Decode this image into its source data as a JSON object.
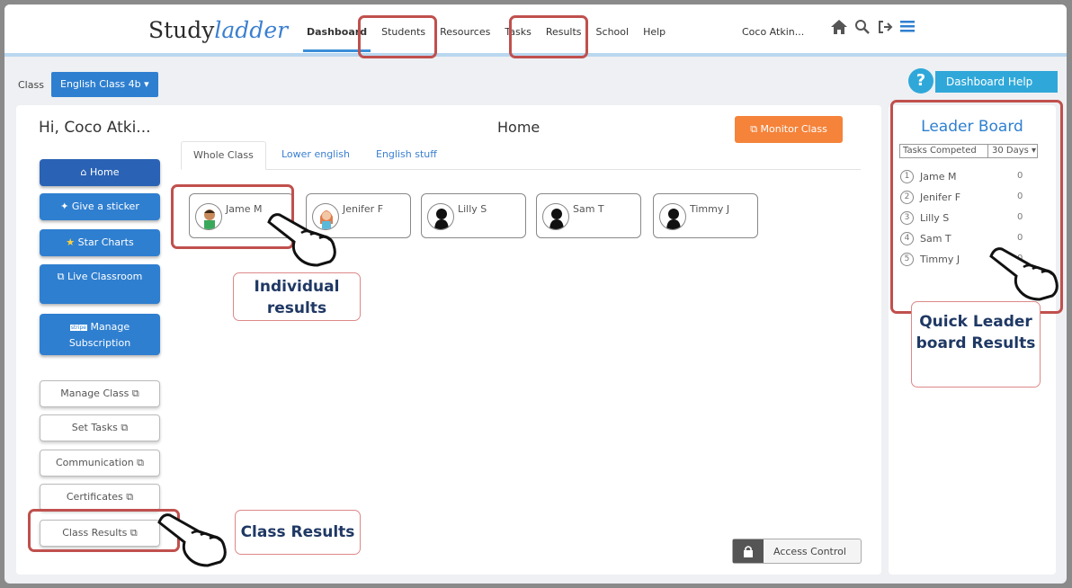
{
  "header": {
    "logo_main": "Study",
    "logo_italic": "ladder",
    "nav": [
      "Dashboard",
      "Students",
      "Resources",
      "Tasks",
      "Results",
      "School",
      "Help"
    ],
    "user_name": "Coco Atkin..."
  },
  "class_bar": {
    "label": "Class",
    "selected_class": "English Class 4b",
    "help_label": "Dashboard Help"
  },
  "main": {
    "greeting": "Hi, Coco Atki...",
    "title": "Home",
    "monitor_label": "Monitor Class",
    "tabs": [
      "Whole Class",
      "Lower english",
      "English stuff"
    ],
    "sidebar_primary": [
      {
        "label": "Home",
        "icon": "home-icon"
      },
      {
        "label": "Give a sticker",
        "icon": "sticker-icon"
      },
      {
        "label": "Star Charts",
        "icon": "star-chart-icon"
      },
      {
        "label": "Live Classroom",
        "icon": "classroom-icon"
      },
      {
        "label": "Manage Subscription",
        "icon": "stripe-icon",
        "icon_text": "stripe"
      }
    ],
    "sidebar_secondary": [
      "Manage Class",
      "Set Tasks",
      "Communication",
      "Certificates",
      "Class Results"
    ],
    "students": [
      {
        "name": "Jame M",
        "avatar": "boy"
      },
      {
        "name": "Jenifer F",
        "avatar": "girl"
      },
      {
        "name": "Lilly S",
        "avatar": "silhouette"
      },
      {
        "name": "Sam T",
        "avatar": "silhouette"
      },
      {
        "name": "Timmy J",
        "avatar": "silhouette"
      }
    ],
    "access_label": "Access Control"
  },
  "leaderboard": {
    "title": "Leader Board",
    "filter_type": "Tasks Competed",
    "filter_period": "30 Days",
    "entries": [
      {
        "rank": "1",
        "name": "Jame M",
        "score": "0"
      },
      {
        "rank": "2",
        "name": "Jenifer F",
        "score": "0"
      },
      {
        "rank": "3",
        "name": "Lilly S",
        "score": "0"
      },
      {
        "rank": "4",
        "name": "Sam T",
        "score": "0"
      },
      {
        "rank": "5",
        "name": "Timmy J",
        "score": "0"
      }
    ]
  },
  "callouts": {
    "individual": [
      "Individual",
      "results"
    ],
    "leader": [
      "Quick Leader",
      "board Results"
    ],
    "class_results": "Class Results"
  },
  "colors": {
    "accent": "#2f7fd0",
    "monitor": "#f5833a",
    "highlight": "#c0504d",
    "callout_text": "#1f3864"
  }
}
